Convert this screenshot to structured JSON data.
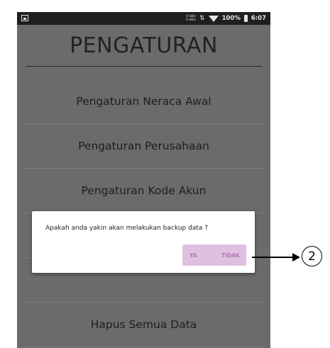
{
  "status_bar": {
    "net_up": "0 kB/s",
    "net_down": "0 kB/s",
    "battery": "100%",
    "time": "6:07"
  },
  "screen": {
    "title": "PENGATURAN",
    "menu_items": [
      {
        "label": "Pengaturan Neraca Awal"
      },
      {
        "label": "Pengaturan Perusahaan"
      },
      {
        "label": "Pengaturan Kode Akun"
      },
      {
        "label": ""
      },
      {
        "label": ""
      },
      {
        "label": "Hapus Semua Data"
      }
    ]
  },
  "dialog": {
    "message": "Apakah anda yakin akan melakukan backup data ?",
    "yes_label": "YA",
    "no_label": "TIDAK"
  },
  "annotation": {
    "number": "2"
  },
  "colors": {
    "screen_bg": "#6b6b6b",
    "statusbar_bg": "#1f1f1f",
    "dialog_button_bg": "#e0c0e0",
    "dialog_button_text": "#b07ab0"
  }
}
